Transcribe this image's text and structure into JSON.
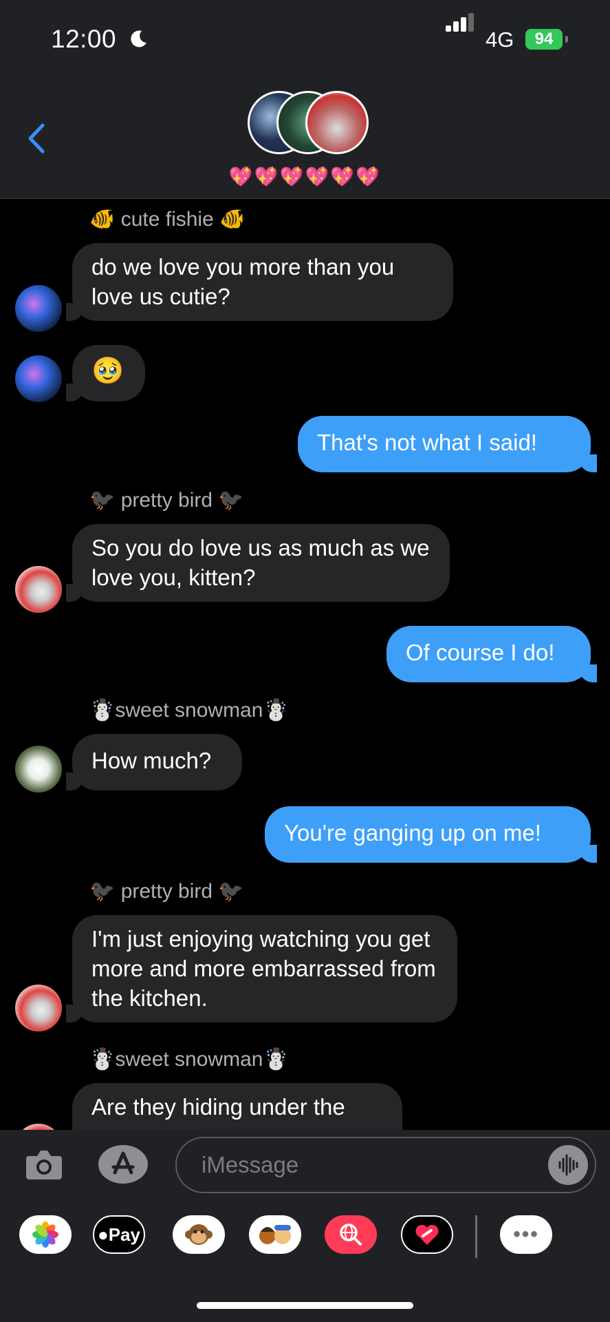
{
  "status_bar": {
    "time": "12:00",
    "network": "4G",
    "battery": "94"
  },
  "header": {
    "group_name": "💖💖💖💖💖💖"
  },
  "messages": [
    {
      "type": "sender",
      "text": "🐠 cute fishie 🐠"
    },
    {
      "type": "incoming",
      "text": "do we love you more than you love us cutie?"
    },
    {
      "type": "incoming",
      "text": "🥹"
    },
    {
      "type": "outgoing",
      "text": "That's not what I said!"
    },
    {
      "type": "sender",
      "text": "🐦‍⬛ pretty bird 🐦‍⬛"
    },
    {
      "type": "incoming",
      "text": "So you do love us as much as we love you, kitten?"
    },
    {
      "type": "outgoing",
      "text": "Of course I do!"
    },
    {
      "type": "sender",
      "text": "☃️sweet snowman☃️"
    },
    {
      "type": "incoming",
      "text": "How much?"
    },
    {
      "type": "outgoing",
      "text": "You're ganging up on me!"
    },
    {
      "type": "sender",
      "text": "🐦‍⬛ pretty bird 🐦‍⬛"
    },
    {
      "type": "incoming",
      "text": "I'm just enjoying watching you get more and more embarrassed from the kitchen."
    },
    {
      "type": "sender",
      "text": "☃️sweet snowman☃️"
    },
    {
      "type": "incoming",
      "text": "Are they hiding under the"
    }
  ],
  "input": {
    "placeholder": "iMessage"
  },
  "app_drawer": {
    "apple_pay_label": "Pay",
    "more_label": "•••"
  },
  "colors": {
    "outgoing_bubble": "#3d9ff8",
    "incoming_bubble": "#262629",
    "battery": "#34c759",
    "back_arrow": "#3a8ef5"
  }
}
